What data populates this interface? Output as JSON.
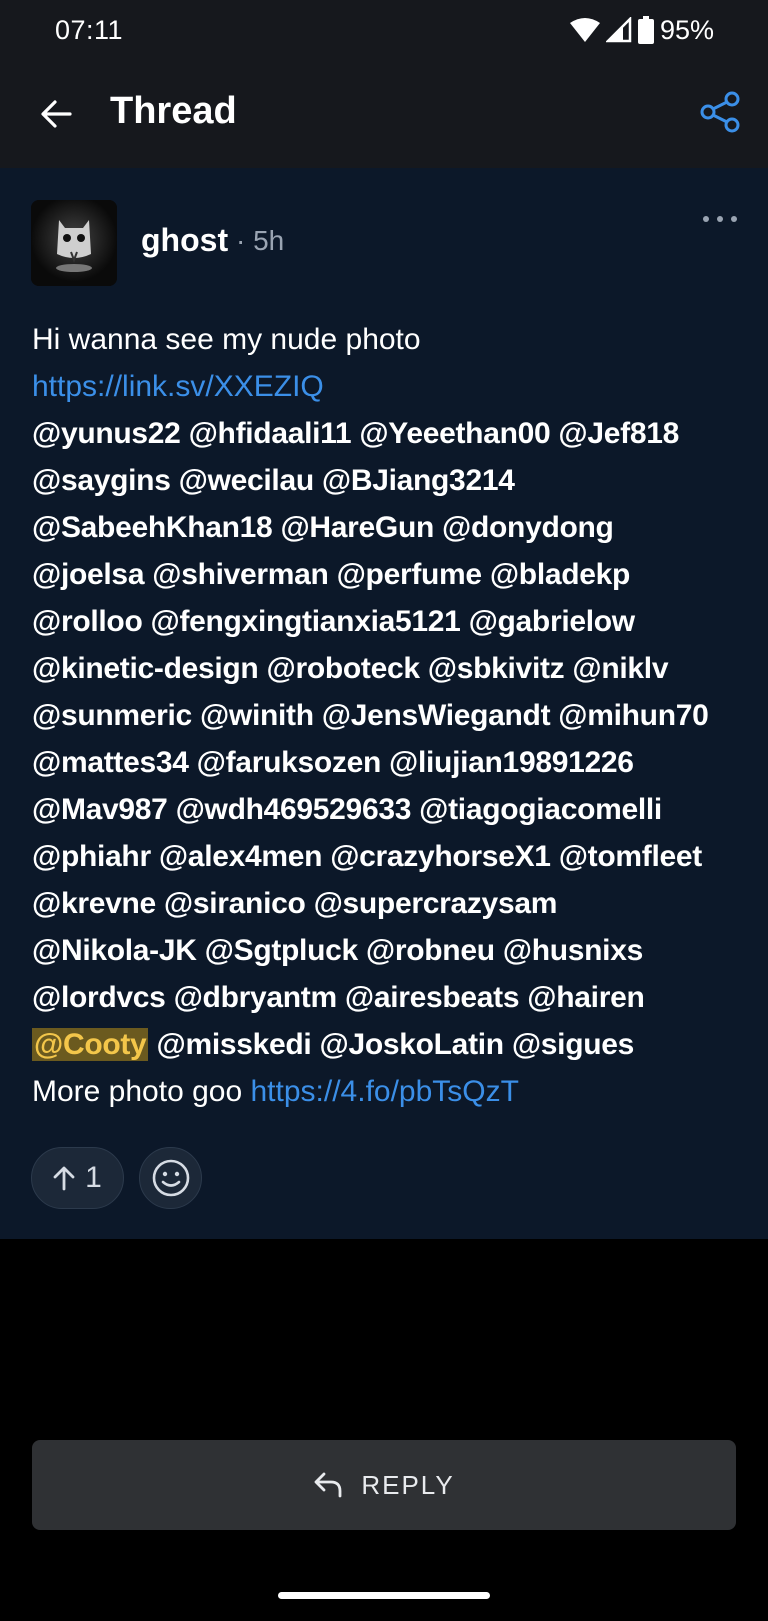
{
  "status_bar": {
    "time": "07:11",
    "battery": "95%"
  },
  "app_bar": {
    "title": "Thread"
  },
  "post": {
    "author": "ghost",
    "time": "· 5h",
    "intro": "Hi wanna see my nude photo",
    "link1": "https://link.sv/XXEZIQ",
    "mention_lines": [
      "@yunus22 @hfidaali11 @Yeeethan00 @Jef818",
      "@saygins @wecilau @BJiang3214",
      "@SabeehKhan18 @HareGun @donydong",
      "@joelsa @shiverman @perfume @bladekp",
      "@rolloo @fengxingtianxia5121 @gabrielow",
      "@kinetic-design @roboteck @sbkivitz @niklv",
      "@sunmeric @winith @JensWiegandt @mihun70",
      "@mattes34 @faruksozen @liujian19891226",
      "@Mav987 @wdh469529633 @tiagogiacomelli",
      "@phiahr @alex4men @crazyhorseX1 @tomfleet",
      "@krevne @siranico @supercrazysam",
      "@Nikola-JK @Sgtpluck @robneu @husnixs",
      "@lordvcs @dbryantm @airesbeats @hairen"
    ],
    "highlighted_mention": "@Cooty",
    "last_mentions": "@misskedi @JoskoLatin @sigues",
    "outro": "More photo goo",
    "link2": "https://4.fo/pbTsQzT",
    "upvotes": "1"
  },
  "reply": {
    "label": "REPLY"
  },
  "colors": {
    "link": "#3b8fe8",
    "post_bg": "#0c1829",
    "highlight_bg": "#6b5a1f",
    "highlight_fg": "#f3c64a"
  }
}
